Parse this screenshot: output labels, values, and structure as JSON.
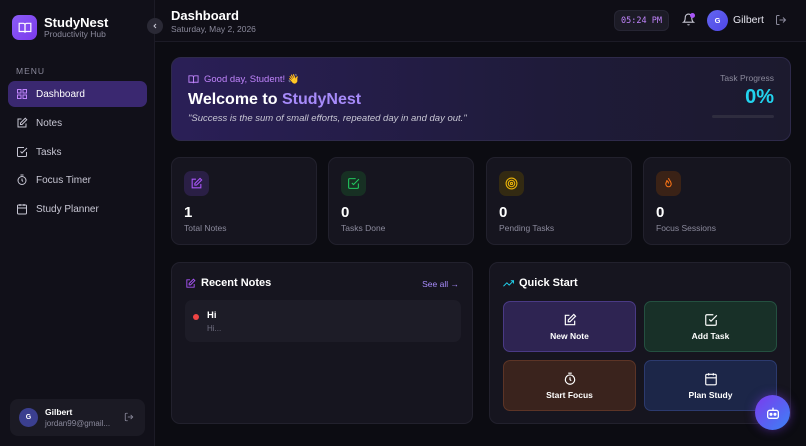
{
  "app": {
    "name": "StudyNest",
    "subtitle": "Productivity Hub"
  },
  "sidebar": {
    "menu_label": "MENU",
    "items": [
      {
        "label": "Dashboard",
        "icon": "grid-icon",
        "active": true
      },
      {
        "label": "Notes",
        "icon": "edit-icon",
        "active": false
      },
      {
        "label": "Tasks",
        "icon": "check-square-icon",
        "active": false
      },
      {
        "label": "Focus Timer",
        "icon": "timer-icon",
        "active": false
      },
      {
        "label": "Study Planner",
        "icon": "calendar-icon",
        "active": false
      }
    ],
    "user": {
      "initial": "G",
      "name": "Gilbert",
      "email": "jordan99@gmail..."
    }
  },
  "header": {
    "title": "Dashboard",
    "date": "Saturday, May 2, 2026",
    "clock": "05:24 PM",
    "user_initial": "G",
    "user_name": "Gilbert"
  },
  "welcome": {
    "greeting": "Good day, Student! 👋",
    "title_prefix": "Welcome to ",
    "title_brand": "StudyNest",
    "quote": "\"Success is the sum of small efforts, repeated day in and day out.\"",
    "progress_label": "Task Progress",
    "progress_value": "0%",
    "progress_fraction": 0
  },
  "stats": [
    {
      "value": "1",
      "label": "Total Notes",
      "icon": "edit-icon",
      "color": "#a855f7"
    },
    {
      "value": "0",
      "label": "Tasks Done",
      "icon": "check-square-icon",
      "color": "#22c55e"
    },
    {
      "value": "0",
      "label": "Pending Tasks",
      "icon": "target-icon",
      "color": "#eab308"
    },
    {
      "value": "0",
      "label": "Focus Sessions",
      "icon": "flame-icon",
      "color": "#f97316"
    }
  ],
  "recent_notes": {
    "title": "Recent Notes",
    "see_all": "See all →",
    "notes": [
      {
        "title": "Hi",
        "preview": "Hi..."
      }
    ]
  },
  "quick_start": {
    "title": "Quick Start",
    "actions": [
      {
        "label": "New Note",
        "icon": "edit-icon"
      },
      {
        "label": "Add Task",
        "icon": "check-square-icon"
      },
      {
        "label": "Start Focus",
        "icon": "timer-icon"
      },
      {
        "label": "Plan Study",
        "icon": "calendar-icon"
      }
    ]
  },
  "colors": {
    "accent": "#a78bfa",
    "progress": "#22d3ee",
    "note_dot": "#ef4444"
  }
}
